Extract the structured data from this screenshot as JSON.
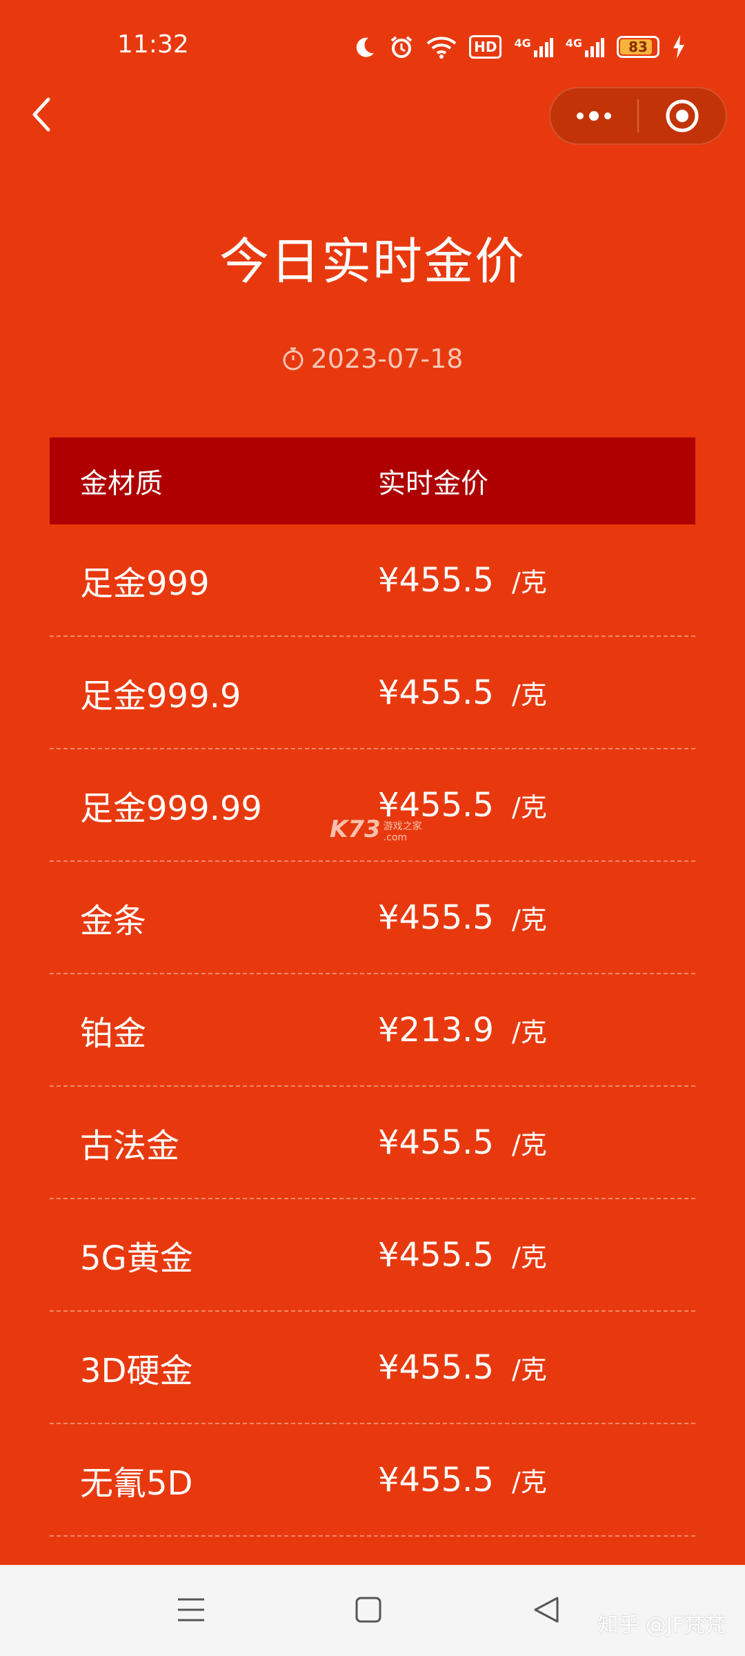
{
  "status_bar": {
    "time": "11:32",
    "icons": [
      "moon-icon",
      "alarm-icon",
      "wifi-icon",
      "hd-icon",
      "signal-4g-icon",
      "signal-4g-icon",
      "battery-icon",
      "charging-icon"
    ],
    "hd_label": "HD",
    "net_label_1": "4G",
    "net_label_2": "4G",
    "battery_level": "83"
  },
  "header": {
    "title": "今日实时金价",
    "date": "2023-07-18"
  },
  "table": {
    "columns": [
      "金材质",
      "实时金价"
    ],
    "rows": [
      {
        "name": "足金999",
        "price": "¥455.5",
        "unit": "/克"
      },
      {
        "name": "足金999.9",
        "price": "¥455.5",
        "unit": "/克"
      },
      {
        "name": "足金999.99",
        "price": "¥455.5",
        "unit": "/克"
      },
      {
        "name": "金条",
        "price": "¥455.5",
        "unit": "/克"
      },
      {
        "name": "铂金",
        "price": "¥213.9",
        "unit": "/克"
      },
      {
        "name": "古法金",
        "price": "¥455.5",
        "unit": "/克"
      },
      {
        "name": "5G黄金",
        "price": "¥455.5",
        "unit": "/克"
      },
      {
        "name": "3D硬金",
        "price": "¥455.5",
        "unit": "/克"
      },
      {
        "name": "无氰5D",
        "price": "¥455.5",
        "unit": "/克"
      }
    ]
  },
  "watermark": {
    "brand": "K73",
    "line1": "游戏之家",
    "line2": ".com"
  },
  "footer_credit": "知乎 @JF梵梵",
  "colors": {
    "background": "#e8390e",
    "header_row": "#ae0000",
    "text": "#ffffff"
  }
}
